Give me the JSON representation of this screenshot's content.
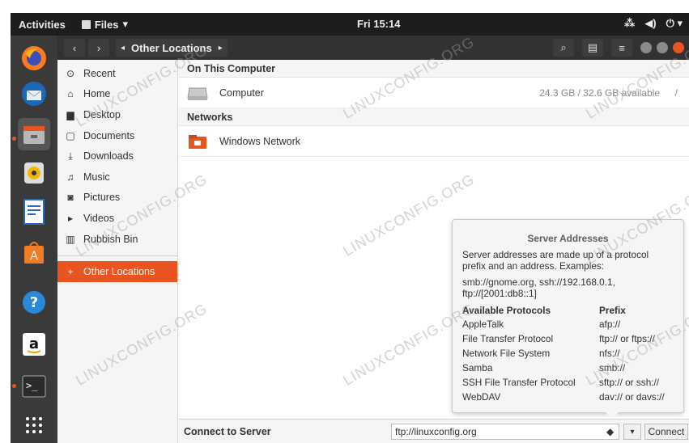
{
  "topbar": {
    "activities": "Activities",
    "app_name": "Files",
    "app_arrow": "▾",
    "clock": "Fri 15:14",
    "network_icon": "network-icon",
    "volume_icon": "volume-icon",
    "power_icon": "power-icon"
  },
  "dock": {
    "items": [
      "firefox-icon",
      "thunderbird-icon",
      "files-icon",
      "rhythmbox-icon",
      "writer-icon",
      "software-icon",
      "help-icon",
      "amazon-icon",
      "terminal-icon",
      "apps-grid-icon"
    ]
  },
  "headerbar": {
    "back": "‹",
    "forward": "›",
    "path_label": "Other Locations",
    "path_left": "◂",
    "path_right": "▸",
    "search_icon": "⌕",
    "view_icon": "▤",
    "menu_icon": "≡"
  },
  "sidebar": {
    "items": [
      {
        "icon": "⊙",
        "label": "Recent"
      },
      {
        "icon": "⌂",
        "label": "Home"
      },
      {
        "icon": "▆",
        "label": "Desktop"
      },
      {
        "icon": "▢",
        "label": "Documents"
      },
      {
        "icon": "⤓",
        "label": "Downloads"
      },
      {
        "icon": "♫",
        "label": "Music"
      },
      {
        "icon": "◙",
        "label": "Pictures"
      },
      {
        "icon": "▸",
        "label": "Videos"
      },
      {
        "icon": "▥",
        "label": "Rubbish Bin"
      }
    ],
    "other": {
      "icon": "+",
      "label": "Other Locations"
    }
  },
  "main": {
    "on_this_computer": "On This Computer",
    "computer_label": "Computer",
    "computer_avail": "24.3 GB / 32.6 GB available",
    "eject": "/",
    "networks": "Networks",
    "windows_network": "Windows Network"
  },
  "popover": {
    "title": "Server Addresses",
    "desc1": "Server addresses are made up of a protocol prefix and an address. Examples:",
    "desc2": "smb://gnome.org, ssh://192.168.0.1, ftp://[2001:db8::1]",
    "col_protocols": "Available Protocols",
    "col_prefix": "Prefix",
    "rows": [
      {
        "protocol": "AppleTalk",
        "prefix": "afp://"
      },
      {
        "protocol": "File Transfer Protocol",
        "prefix": "ftp:// or ftps://"
      },
      {
        "protocol": "Network File System",
        "prefix": "nfs://"
      },
      {
        "protocol": "Samba",
        "prefix": "smb://"
      },
      {
        "protocol": "SSH File Transfer Protocol",
        "prefix": "sftp:// or ssh://"
      },
      {
        "protocol": "WebDAV",
        "prefix": "dav:// or davs://"
      }
    ]
  },
  "bottom": {
    "connect_to_server": "Connect to Server",
    "server_value": "ftp://linuxconfig.org",
    "help_glyph": "◆",
    "dropdown_glyph": "▾",
    "connect_label": "Connect"
  },
  "watermark": "LINUXCONFIG.ORG",
  "colors": {
    "accent": "#e95420",
    "topbar": "#1d1d1d",
    "dock": "#3a3a3a"
  }
}
